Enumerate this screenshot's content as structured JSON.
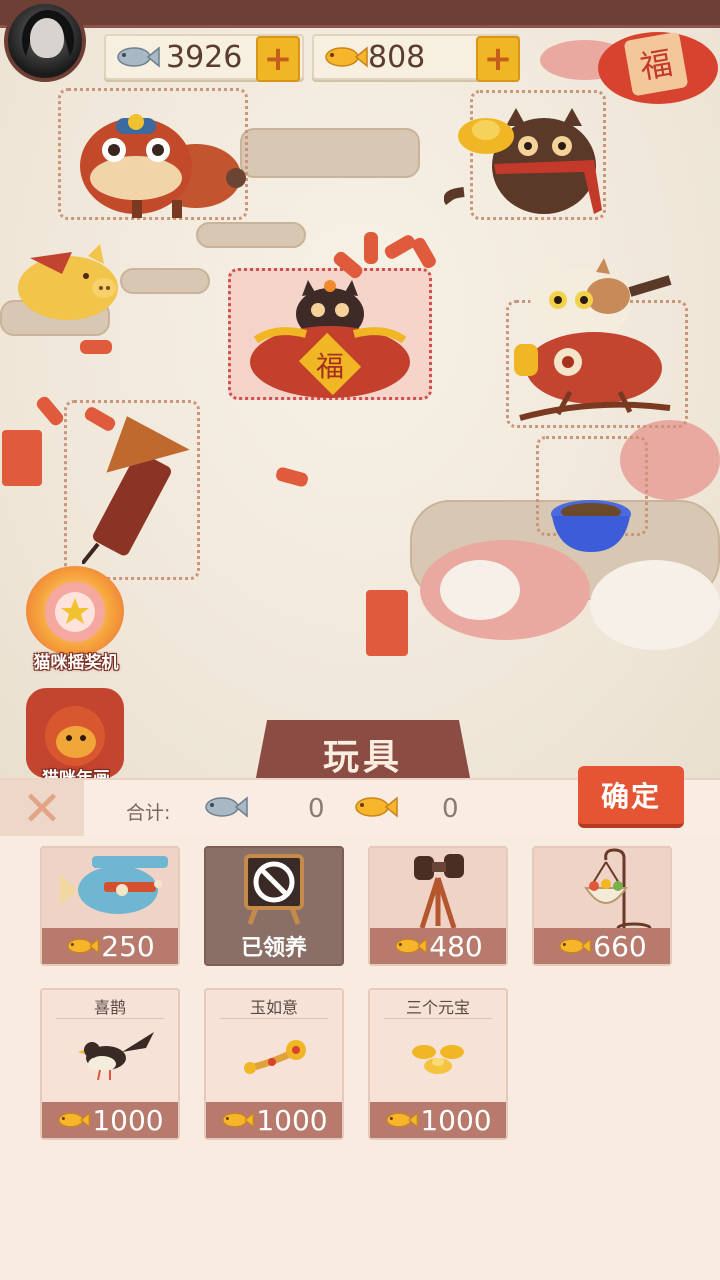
{
  "header": {
    "silver_fish": "3926",
    "gold_fish": "808",
    "add_label": "+"
  },
  "scene": {
    "slot_machine_label": "猫咪摇奖机",
    "new_year_label": "猫咪年画",
    "fu_char": "福"
  },
  "panel": {
    "title": "玩具",
    "close_label": "✕",
    "total_label": "合计:",
    "total_silver": "0",
    "total_gold": "0",
    "confirm_label": "确定"
  },
  "toys": [
    {
      "name": "",
      "price": "250",
      "icon": "airplane-icon",
      "state": "available"
    },
    {
      "name": "",
      "price": "已领养",
      "icon": "prohibited-sign-icon",
      "state": "adopted"
    },
    {
      "name": "",
      "price": "480",
      "icon": "binoculars-icon",
      "state": "available"
    },
    {
      "name": "",
      "price": "660",
      "icon": "hanging-basket-icon",
      "state": "available"
    },
    {
      "name": "喜鹊",
      "price": "1000",
      "icon": "magpie-icon",
      "state": "available"
    },
    {
      "name": "玉如意",
      "price": "1000",
      "icon": "ruyi-icon",
      "state": "available"
    },
    {
      "name": "三个元宝",
      "price": "1000",
      "icon": "gold-ingots-icon",
      "state": "available"
    }
  ],
  "colors": {
    "accent_red": "#e55533",
    "panel_brown": "#8b4d43",
    "price_bar": "#b97a6e",
    "gold": "#f1b623"
  }
}
